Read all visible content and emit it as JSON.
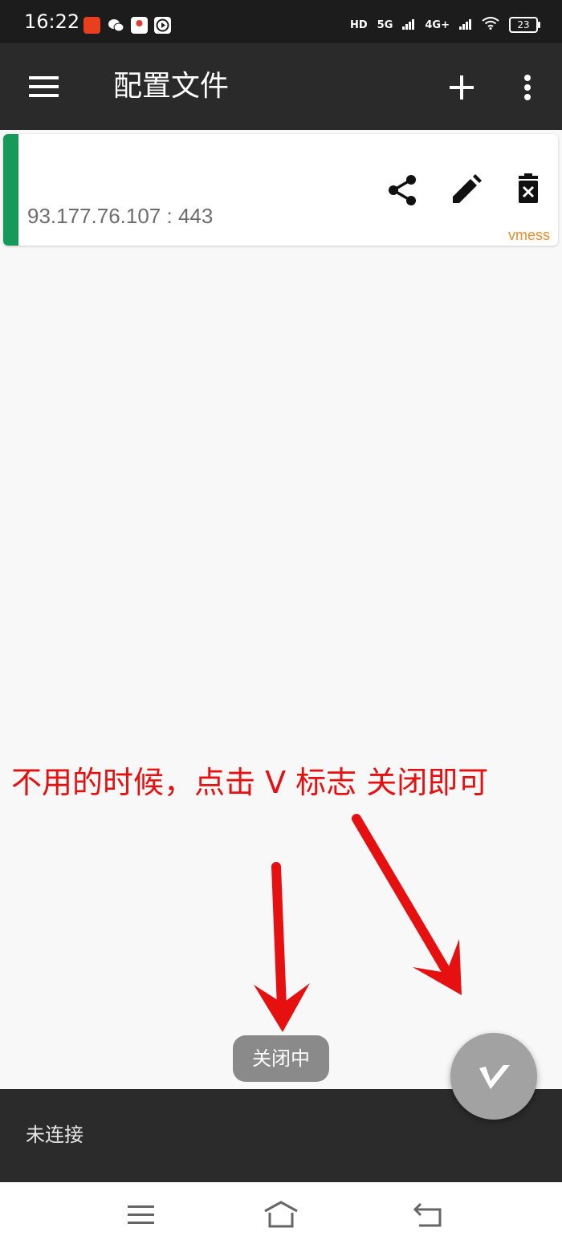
{
  "status_bar": {
    "time": "16:22",
    "network_labels": [
      "HD",
      "5G",
      "4G+"
    ],
    "battery": "23",
    "app_icons": [
      "news-app-icon",
      "wechat-icon",
      "map-app-icon",
      "video-app-icon"
    ]
  },
  "toolbar": {
    "title": "配置文件",
    "icons": [
      "menu-icon",
      "add-icon",
      "more-vert-icon"
    ]
  },
  "profile": {
    "address": "93.177.76.107 : 443",
    "type": "vmess",
    "selected_color": "#159a5a",
    "actions": [
      "share-icon",
      "edit-icon",
      "delete-icon"
    ]
  },
  "annotation": {
    "text": "不用的时候，点击 V 标志 关闭即可",
    "color": "#e61010"
  },
  "toast": {
    "text": "关闭中"
  },
  "bottom_bar": {
    "status": "未连接"
  },
  "fab": {
    "icon": "v-logo-icon"
  },
  "navigation_bar": {
    "buttons": [
      "recents-icon",
      "home-icon",
      "back-icon"
    ]
  }
}
